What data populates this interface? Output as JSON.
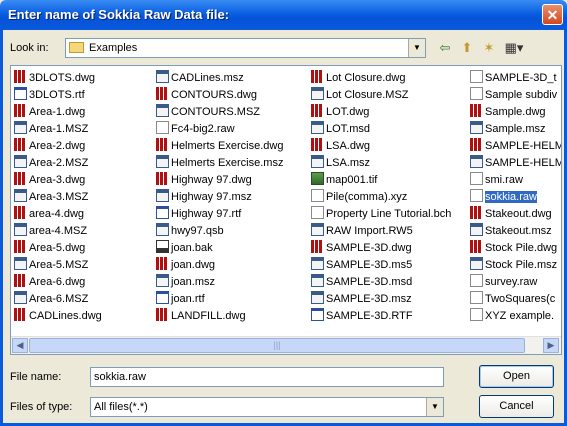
{
  "window": {
    "title": "Enter name of Sokkia Raw Data file:",
    "close_glyph": "✕"
  },
  "toolbar": {
    "look_in_label": "Look in:",
    "look_in_value": "Examples",
    "back_glyph": "⇦",
    "up_glyph": "⬆",
    "newfolder_glyph": "✶",
    "views_glyph": "▦▾"
  },
  "files": {
    "columns": [
      [
        {
          "name": "3DLOTS.dwg",
          "icon": "dwg"
        },
        {
          "name": "3DLOTS.rtf",
          "icon": "rtf"
        },
        {
          "name": "Area-1.dwg",
          "icon": "dwg"
        },
        {
          "name": "Area-1.MSZ",
          "icon": "msz"
        },
        {
          "name": "Area-2.dwg",
          "icon": "dwg"
        },
        {
          "name": "Area-2.MSZ",
          "icon": "msz"
        },
        {
          "name": "Area-3.dwg",
          "icon": "dwg"
        },
        {
          "name": "Area-3.MSZ",
          "icon": "msz"
        },
        {
          "name": "area-4.dwg",
          "icon": "dwg"
        },
        {
          "name": "area-4.MSZ",
          "icon": "msz"
        },
        {
          "name": "Area-5.dwg",
          "icon": "dwg"
        },
        {
          "name": "Area-5.MSZ",
          "icon": "msz"
        },
        {
          "name": "Area-6.dwg",
          "icon": "dwg"
        },
        {
          "name": "Area-6.MSZ",
          "icon": "msz"
        },
        {
          "name": "CADLines.dwg",
          "icon": "dwg"
        }
      ],
      [
        {
          "name": "CADLines.msz",
          "icon": "msz"
        },
        {
          "name": "CONTOURS.dwg",
          "icon": "dwg"
        },
        {
          "name": "CONTOURS.MSZ",
          "icon": "msz"
        },
        {
          "name": "Fc4-big2.raw",
          "icon": "gen"
        },
        {
          "name": "Helmerts Exercise.dwg",
          "icon": "dwg"
        },
        {
          "name": "Helmerts Exercise.msz",
          "icon": "msz"
        },
        {
          "name": "Highway 97.dwg",
          "icon": "dwg"
        },
        {
          "name": "Highway 97.msz",
          "icon": "msz"
        },
        {
          "name": "Highway 97.rtf",
          "icon": "rtf"
        },
        {
          "name": "hwy97.qsb",
          "icon": "msz"
        },
        {
          "name": "joan.bak",
          "icon": "bak"
        },
        {
          "name": "joan.dwg",
          "icon": "dwg"
        },
        {
          "name": "joan.msz",
          "icon": "msz"
        },
        {
          "name": "joan.rtf",
          "icon": "rtf"
        },
        {
          "name": "LANDFILL.dwg",
          "icon": "dwg"
        }
      ],
      [
        {
          "name": "Lot Closure.dwg",
          "icon": "dwg"
        },
        {
          "name": "Lot Closure.MSZ",
          "icon": "msz"
        },
        {
          "name": "LOT.dwg",
          "icon": "dwg"
        },
        {
          "name": "LOT.msd",
          "icon": "msz"
        },
        {
          "name": "LSA.dwg",
          "icon": "dwg"
        },
        {
          "name": "LSA.msz",
          "icon": "msz"
        },
        {
          "name": "map001.tif",
          "icon": "tif"
        },
        {
          "name": "Pile(comma).xyz",
          "icon": "gen"
        },
        {
          "name": "Property Line Tutorial.bch",
          "icon": "gen"
        },
        {
          "name": "RAW Import.RW5",
          "icon": "msz"
        },
        {
          "name": "SAMPLE-3D.dwg",
          "icon": "dwg"
        },
        {
          "name": "SAMPLE-3D.ms5",
          "icon": "msz"
        },
        {
          "name": "SAMPLE-3D.msd",
          "icon": "msz"
        },
        {
          "name": "SAMPLE-3D.msz",
          "icon": "msz"
        },
        {
          "name": "SAMPLE-3D.RTF",
          "icon": "rtf"
        }
      ],
      [
        {
          "name": "SAMPLE-3D_t",
          "icon": "gen"
        },
        {
          "name": "Sample subdiv",
          "icon": "gen"
        },
        {
          "name": "Sample.dwg",
          "icon": "dwg"
        },
        {
          "name": "Sample.msz",
          "icon": "msz"
        },
        {
          "name": "SAMPLE-HELM",
          "icon": "dwg"
        },
        {
          "name": "SAMPLE-HELM",
          "icon": "msz"
        },
        {
          "name": "smi.raw",
          "icon": "gen"
        },
        {
          "name": "sokkia.raw",
          "icon": "gen",
          "selected": true
        },
        {
          "name": "Stakeout.dwg",
          "icon": "dwg"
        },
        {
          "name": "Stakeout.msz",
          "icon": "msz"
        },
        {
          "name": "Stock Pile.dwg",
          "icon": "dwg"
        },
        {
          "name": "Stock Pile.msz",
          "icon": "msz"
        },
        {
          "name": "survey.raw",
          "icon": "gen"
        },
        {
          "name": "TwoSquares(c",
          "icon": "gen"
        },
        {
          "name": "XYZ example.",
          "icon": "gen"
        }
      ]
    ]
  },
  "scrollbar": {
    "left_glyph": "◀",
    "right_glyph": "▶",
    "grip": "|||"
  },
  "form": {
    "file_name_label": "File name:",
    "file_name_value": "sokkia.raw",
    "file_type_label": "Files of type:",
    "file_type_value": "All files(*.*)",
    "open_label": "Open",
    "cancel_label": "Cancel"
  }
}
